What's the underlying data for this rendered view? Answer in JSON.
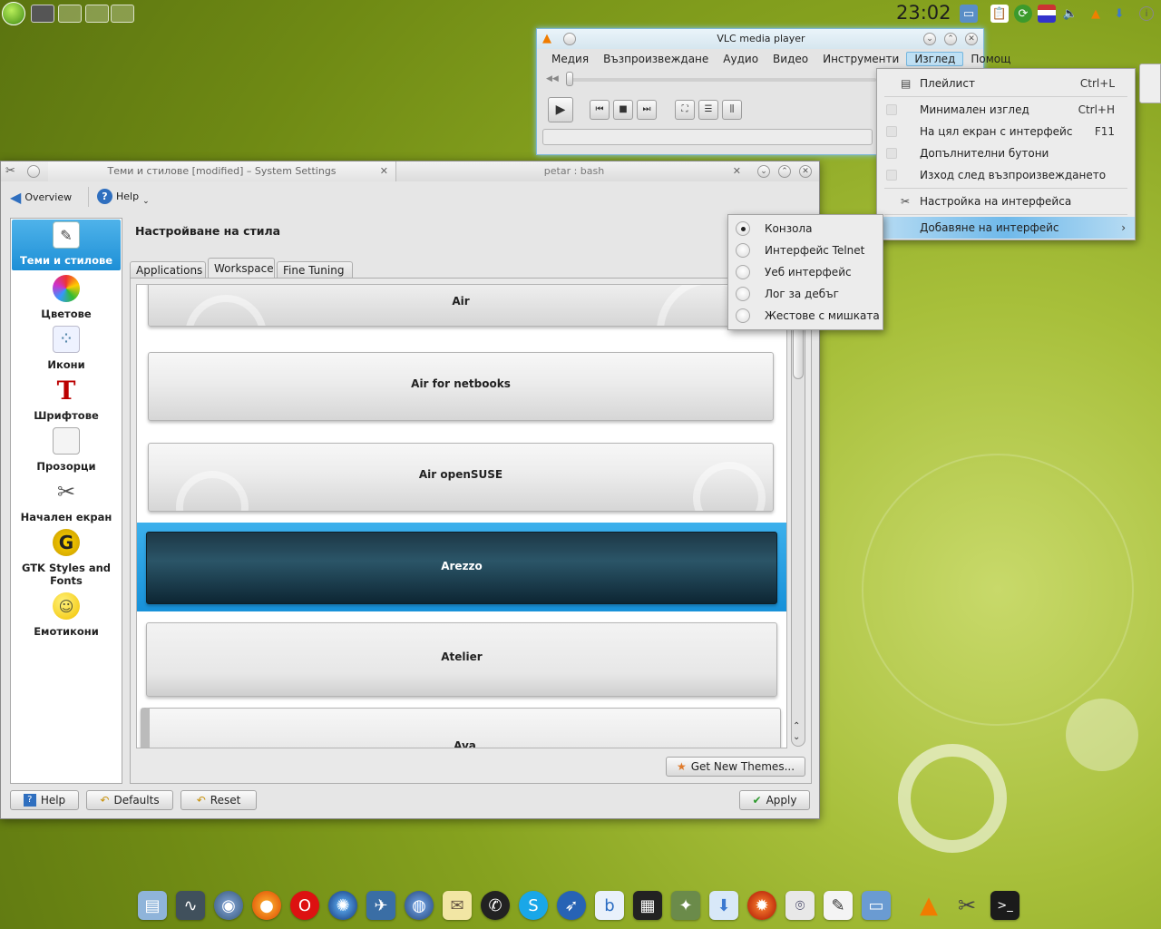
{
  "top_panel": {
    "clock": "23:02"
  },
  "vlc": {
    "title": "VLC media player",
    "menu": [
      "Медия",
      "Възпроизвеждане",
      "Аудио",
      "Видео",
      "Инструменти",
      "Изглед",
      "Помощ"
    ],
    "active_menu": "Изглед"
  },
  "view_menu": {
    "items": [
      {
        "label": "Плейлист",
        "shortcut": "Ctrl+L",
        "icon": "playlist-icon"
      },
      {
        "label": "Минимален изглед",
        "shortcut": "Ctrl+H"
      },
      {
        "label": "На цял екран с интерфейс",
        "shortcut": "F11"
      },
      {
        "label": "Допълнителни бутони",
        "shortcut": ""
      },
      {
        "label": "Изход след възпроизвеждането",
        "shortcut": ""
      },
      {
        "label": "Настройка на интерфейса",
        "shortcut": "",
        "icon": "tools-icon"
      },
      {
        "label": "Добавяне на интерфейс",
        "shortcut": "",
        "submenu": true
      }
    ]
  },
  "interface_menu": {
    "items": [
      {
        "label": "Конзола",
        "checked": true
      },
      {
        "label": "Интерфейс Telnet",
        "checked": false
      },
      {
        "label": "Уеб интерфейс",
        "checked": false
      },
      {
        "label": "Лог за дебъг",
        "checked": false
      },
      {
        "label": "Жестове с мишката",
        "checked": false
      }
    ]
  },
  "system_settings": {
    "tab1_title": "Теми и стилове [modified] – System Settings",
    "tab2_title": "petar : bash",
    "toolbar": {
      "overview": "Overview",
      "help": "Help"
    },
    "sidebar": [
      {
        "label": "Теми и стилове",
        "icon": "themes-icon",
        "selected": true
      },
      {
        "label": "Цветове",
        "icon": "colors-icon"
      },
      {
        "label": "Икони",
        "icon": "icons-icon"
      },
      {
        "label": "Шрифтове",
        "icon": "fonts-icon"
      },
      {
        "label": "Прозорци",
        "icon": "windows-icon"
      },
      {
        "label": "Начален екран",
        "icon": "splash-icon"
      },
      {
        "label": "GTK Styles and Fonts",
        "icon": "gtk-icon"
      },
      {
        "label": "Емотикони",
        "icon": "emoticons-icon"
      }
    ],
    "page_title": "Настройване на стила",
    "tabs": [
      "Applications",
      "Workspace",
      "Fine Tuning"
    ],
    "active_tab": "Workspace",
    "themes": [
      "Air",
      "Air for netbooks",
      "Air openSUSE",
      "Arezzo",
      "Atelier",
      "Ava"
    ],
    "selected_theme": "Arezzo",
    "get_new_themes": "Get New Themes...",
    "buttons": {
      "help": "Help",
      "defaults": "Defaults",
      "reset": "Reset",
      "apply": "Apply"
    }
  },
  "dock": [
    "file-manager-icon",
    "system-monitor-icon",
    "chromium-icon",
    "firefox-icon",
    "opera-icon",
    "network-icon",
    "kopete-icon",
    "web-icon",
    "notes-icon",
    "chat-icon",
    "skype-icon",
    "rekonq-icon",
    "blogilo-icon",
    "video-editor-icon",
    "satellite-icon",
    "download-icon",
    "burner-icon",
    "photo-icon",
    "editor-icon",
    "remote-desktop-icon",
    "vlc-icon",
    "settings-icon",
    "terminal-icon"
  ]
}
